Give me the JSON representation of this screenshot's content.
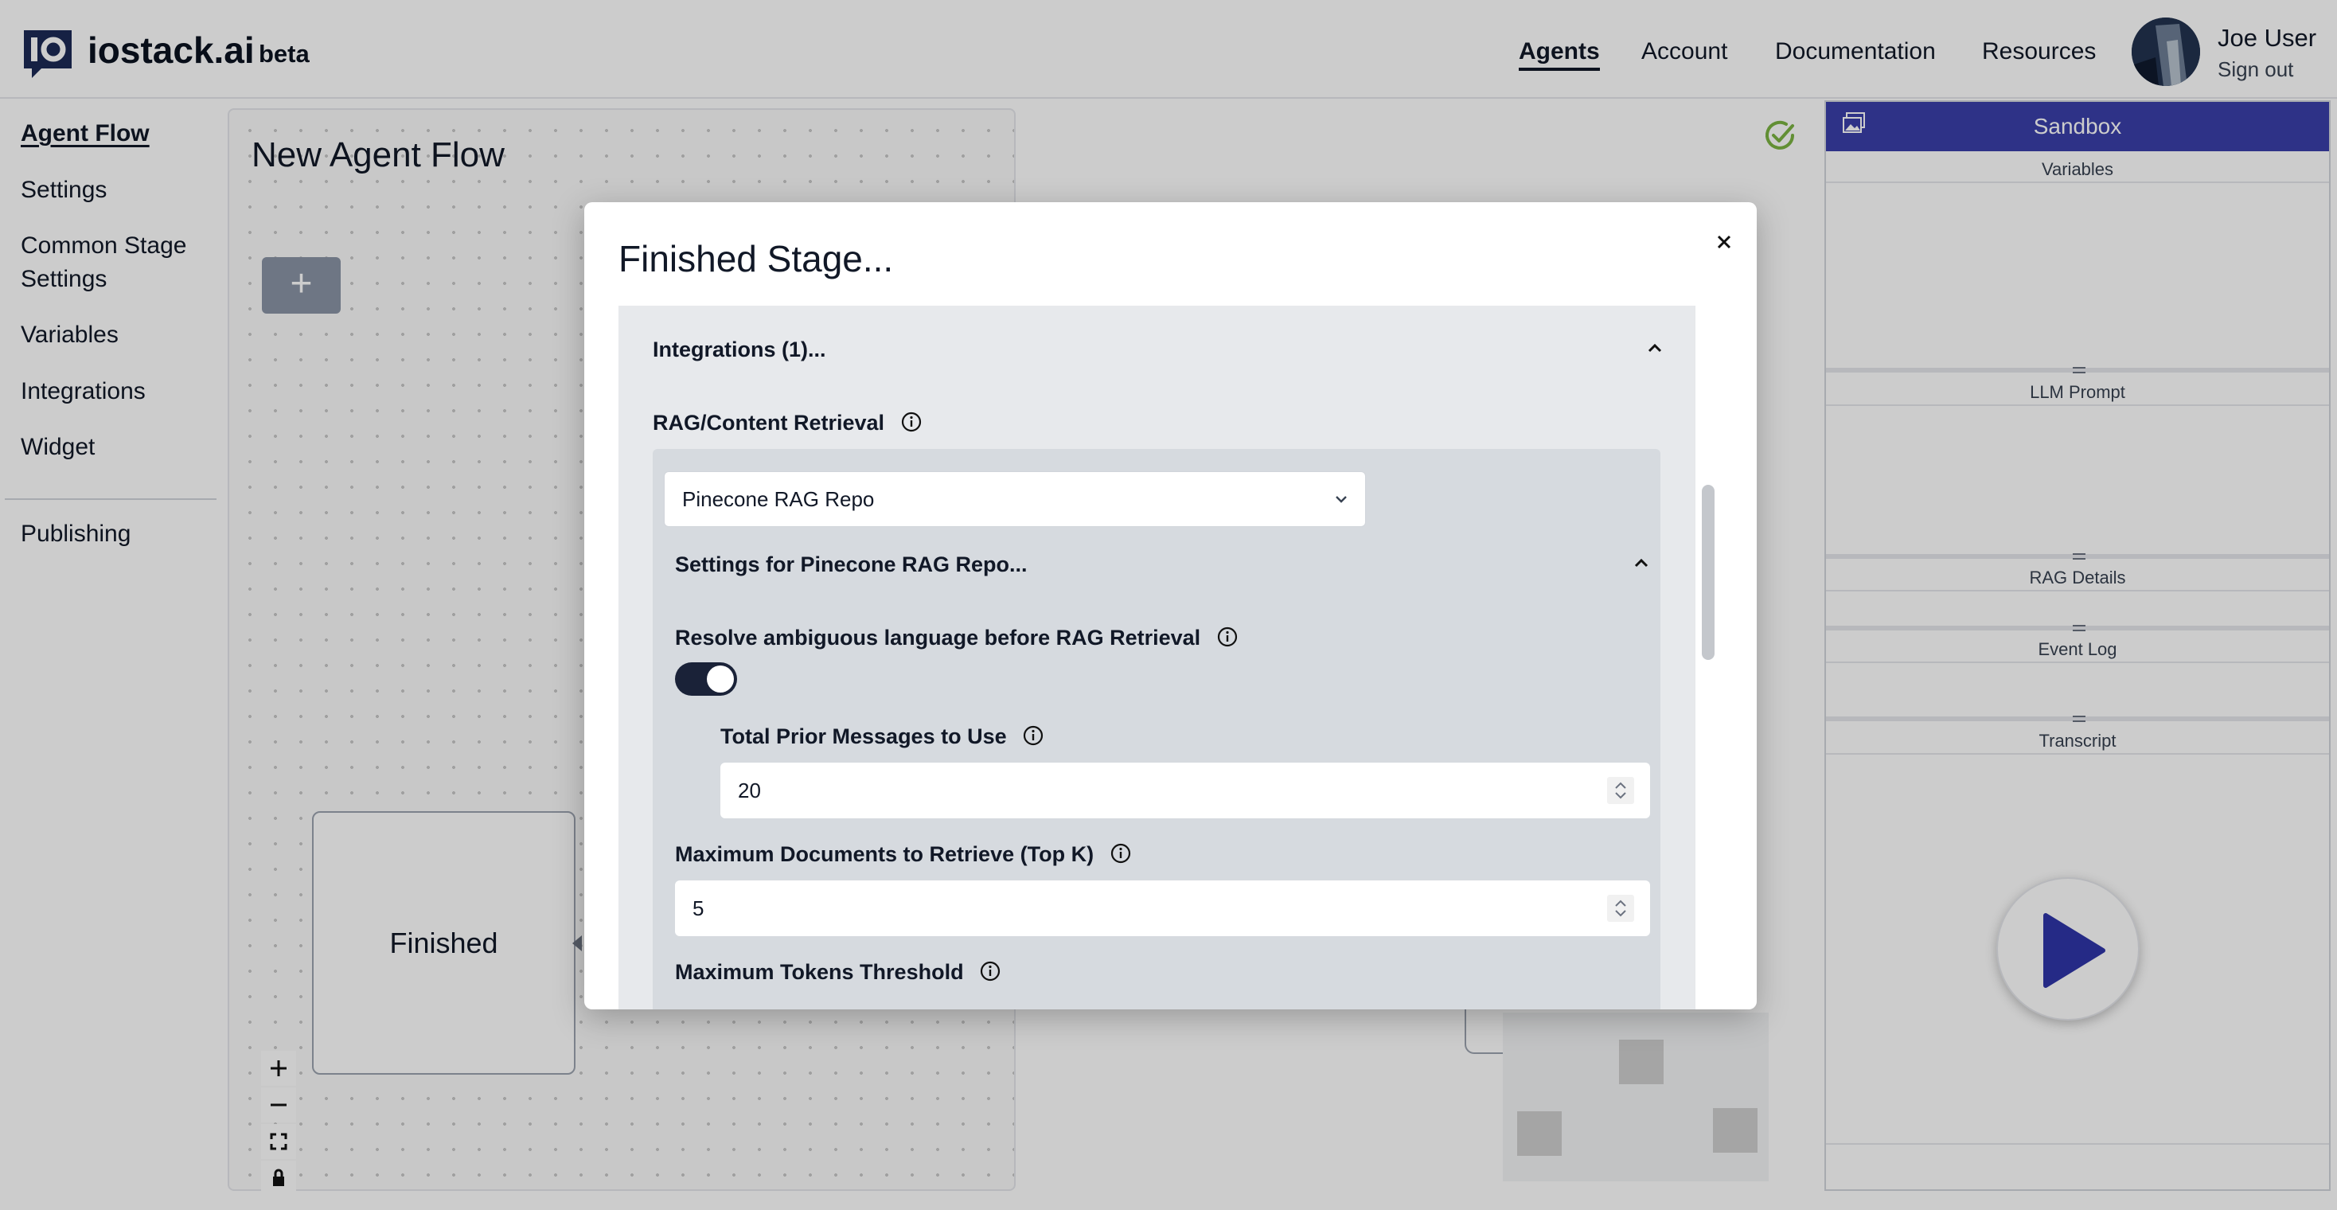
{
  "header": {
    "brand": "iostack.ai",
    "brand_tag": "beta",
    "nav": [
      "Agents",
      "Account",
      "Documentation",
      "Resources"
    ],
    "active_nav": "Agents",
    "user_name": "Joe User",
    "sign_out": "Sign out"
  },
  "sidebar": {
    "items": [
      "Agent Flow",
      "Settings",
      "Common Stage Settings",
      "Variables",
      "Integrations",
      "Widget",
      "Publishing"
    ],
    "active": "Agent Flow"
  },
  "canvas": {
    "title": "New Agent Flow",
    "add_button": "+",
    "node_label": "Finished",
    "zoom_controls": [
      "zoom-in",
      "zoom-out",
      "fit-view",
      "lock"
    ]
  },
  "sandbox": {
    "title": "Sandbox",
    "sections": [
      "Variables",
      "LLM Prompt",
      "RAG Details",
      "Event Log",
      "Transcript"
    ]
  },
  "modal": {
    "title": "Finished Stage...",
    "integrations_header": "Integrations (1)...",
    "rag_label": "RAG/Content Retrieval",
    "rag_select_value": "Pinecone RAG Repo",
    "settings_header": "Settings for Pinecone RAG Repo...",
    "resolve_label": "Resolve ambiguous language before RAG Retrieval",
    "resolve_enabled": true,
    "prior_label": "Total Prior Messages to Use",
    "prior_value": "20",
    "topk_label": "Maximum Documents to Retrieve (Top K)",
    "topk_value": "5",
    "tokens_label": "Maximum Tokens Threshold"
  },
  "colors": {
    "sandbox_header": "#3a3fa9",
    "toggle_on": "#1a2238",
    "play_icon": "#2f35a8",
    "saved_check": "#7bb342"
  }
}
